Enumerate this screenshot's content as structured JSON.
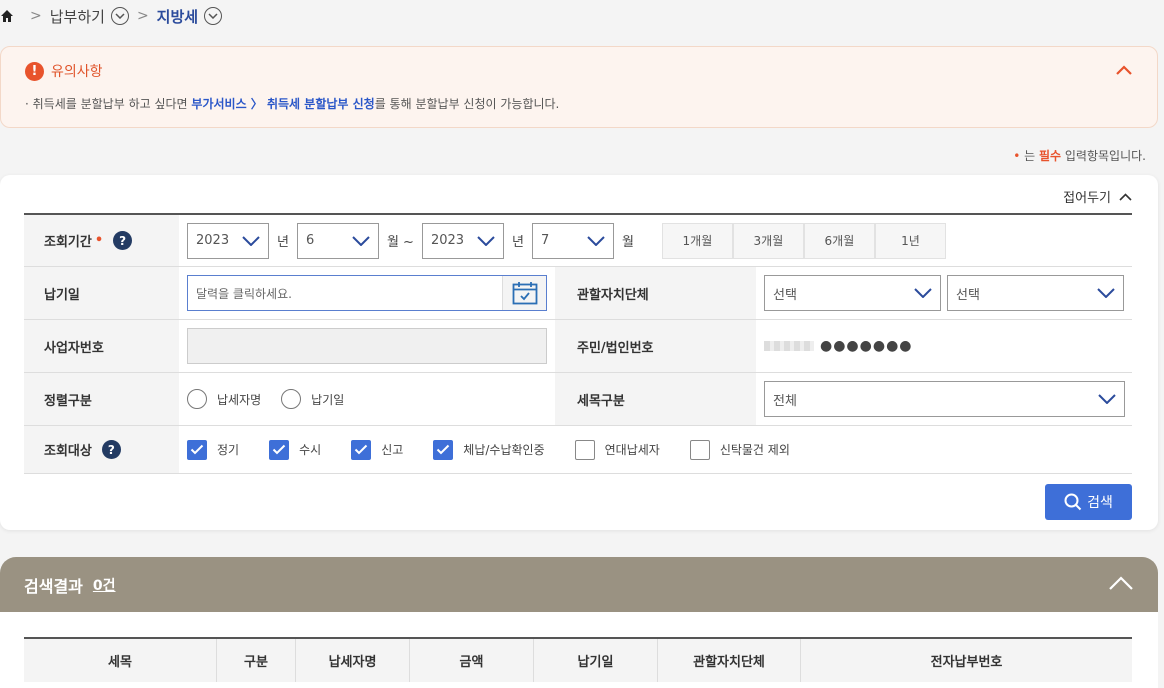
{
  "breadcrumb": {
    "level1": "납부하기",
    "current": "지방세"
  },
  "notice": {
    "title": "유의사항",
    "text_before": "· 취득세를 분할납부 하고 싶다면 ",
    "highlight": "부가서비스 〉 취득세 분할납부 신청",
    "text_after": "를 통해 분할납부 신청이 가능합니다."
  },
  "required_note": {
    "prefix": "는 ",
    "red": "필수",
    "suffix": " 입력항목입니다."
  },
  "panel": {
    "collapse_label": "접어두기"
  },
  "form": {
    "period": {
      "label": "조회기간",
      "start_year": "2023",
      "start_month": "6",
      "end_year": "2023",
      "end_month": "7",
      "year_unit": "년",
      "month_unit_tilde": "월 ~",
      "month_unit": "월",
      "quick": [
        "1개월",
        "3개월",
        "6개월",
        "1년"
      ]
    },
    "due_date": {
      "label": "납기일",
      "placeholder": "달력을 클릭하세요."
    },
    "jurisdiction": {
      "label": "관할자치단체",
      "select1": "선택",
      "select2": "선택"
    },
    "business_no": {
      "label": "사업자번호"
    },
    "resident_no": {
      "label": "주민/법인번호",
      "masked": "●●●●●●●"
    },
    "sort": {
      "label": "정렬구분",
      "options": [
        "납세자명",
        "납기일"
      ]
    },
    "tax_type": {
      "label": "세목구분",
      "value": "전체"
    },
    "target": {
      "label": "조회대상",
      "options": [
        {
          "label": "정기",
          "checked": true
        },
        {
          "label": "수시",
          "checked": true
        },
        {
          "label": "신고",
          "checked": true
        },
        {
          "label": "체납/수납확인중",
          "checked": true
        },
        {
          "label": "연대납세자",
          "checked": false
        },
        {
          "label": "신탁물건 제외",
          "checked": false
        }
      ]
    }
  },
  "search_button": "검색",
  "result": {
    "title": "검색결과",
    "count": "0건",
    "columns": [
      "세목",
      "구분",
      "납세자명",
      "금액",
      "납기일",
      "관할자치단체",
      "전자납부번호"
    ]
  },
  "colors": {
    "accent": "#3e6fd8",
    "warning": "#e8532c",
    "result_bar": "#9a9282"
  }
}
